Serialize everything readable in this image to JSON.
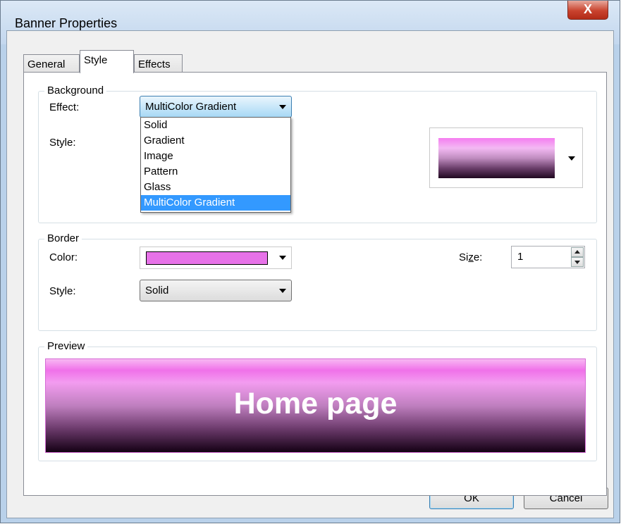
{
  "window": {
    "title": "Banner Properties",
    "close_glyph": "X"
  },
  "tabs": [
    {
      "label": "General"
    },
    {
      "label": "Style",
      "active": true
    },
    {
      "label": "Effects"
    }
  ],
  "background": {
    "group_label": "Background",
    "effect_label": "Effect:",
    "effect_value": "MultiColor Gradient",
    "style_label": "Style:",
    "effect_options": [
      "Solid",
      "Gradient",
      "Image",
      "Pattern",
      "Glass",
      "MultiColor Gradient"
    ],
    "selected_option": "MultiColor Gradient"
  },
  "border": {
    "group_label": "Border",
    "color_label": "Color:",
    "color_value": "#e772e8",
    "style_label": "Style:",
    "style_value": "Solid",
    "size_label_pre": "Si",
    "size_label_accel": "z",
    "size_label_post": "e:",
    "size_value": "1"
  },
  "preview": {
    "group_label": "Preview",
    "banner_text": "Home page"
  },
  "buttons": {
    "ok": "OK",
    "cancel": "Cancel"
  },
  "colors": {
    "selection": "#3399ff",
    "border_color": "#e772e8",
    "title_bar": "#c3d7ee"
  }
}
